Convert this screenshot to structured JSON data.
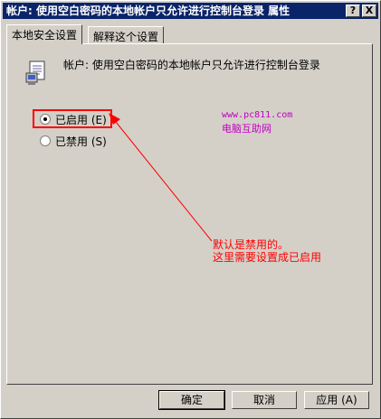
{
  "window": {
    "title": "帐户: 使用空白密码的本地帐户只允许进行控制台登录 属性",
    "help_button": "?",
    "close_button": "X"
  },
  "tabs": [
    {
      "label": "本地安全设置",
      "active": true
    },
    {
      "label": "解释这个设置",
      "active": false
    }
  ],
  "policy": {
    "name": "帐户: 使用空白密码的本地帐户只允许进行控制台登录",
    "icon": "policy-document-icon"
  },
  "options": [
    {
      "label": "已启用 (E)",
      "checked": true
    },
    {
      "label": "已禁用 (S)",
      "checked": false
    }
  ],
  "watermark": {
    "url": "www.pc811.com",
    "name": "电脑互助网"
  },
  "annotation": {
    "line1": "默认是禁用的。",
    "line2": "这里需要设置成已启用",
    "color": "#ff0000"
  },
  "buttons": {
    "ok": "确定",
    "cancel": "取消",
    "apply": "应用 (A)"
  },
  "colors": {
    "titlebar": "#0a246a",
    "face": "#d4d0c8",
    "watermark": "#c000c0"
  }
}
